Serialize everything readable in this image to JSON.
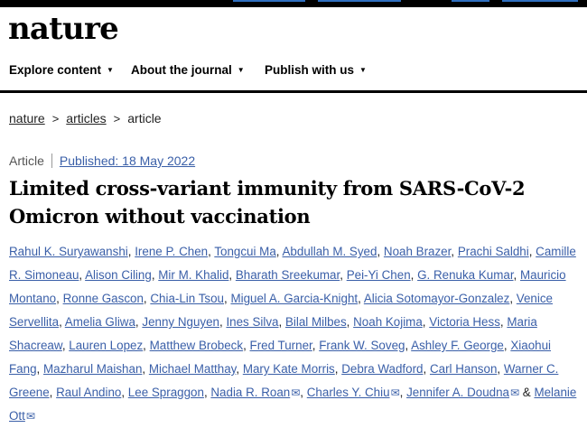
{
  "header": {
    "logo": "nature",
    "nav": [
      {
        "label": "Explore content"
      },
      {
        "label": "About the journal"
      },
      {
        "label": "Publish with us"
      }
    ]
  },
  "breadcrumb": [
    "nature",
    "articles",
    "article"
  ],
  "article": {
    "type": "Article",
    "published": "Published: 18 May 2022",
    "title_line1": "Limited cross-variant immunity from SARS-CoV-2",
    "title_line2": "Omicron without vaccination"
  },
  "authors": [
    {
      "name": "Rahul K. Suryawanshi"
    },
    {
      "name": "Irene P. Chen"
    },
    {
      "name": "Tongcui Ma"
    },
    {
      "name": "Abdullah M. Syed"
    },
    {
      "name": "Noah Brazer"
    },
    {
      "name": "Prachi Saldhi"
    },
    {
      "name": "Camille R. Simoneau"
    },
    {
      "name": "Alison Ciling"
    },
    {
      "name": "Mir M. Khalid"
    },
    {
      "name": "Bharath Sreekumar"
    },
    {
      "name": "Pei-Yi Chen"
    },
    {
      "name": "G. Renuka Kumar"
    },
    {
      "name": "Mauricio Montano"
    },
    {
      "name": "Ronne Gascon"
    },
    {
      "name": "Chia-Lin Tsou"
    },
    {
      "name": "Miguel A. Garcia-Knight"
    },
    {
      "name": "Alicia Sotomayor-Gonzalez"
    },
    {
      "name": "Venice Servellita"
    },
    {
      "name": "Amelia Gliwa"
    },
    {
      "name": "Jenny Nguyen"
    },
    {
      "name": "Ines Silva"
    },
    {
      "name": "Bilal Milbes"
    },
    {
      "name": "Noah Kojima"
    },
    {
      "name": "Victoria Hess"
    },
    {
      "name": "Maria Shacreaw"
    },
    {
      "name": "Lauren Lopez"
    },
    {
      "name": "Matthew Brobeck"
    },
    {
      "name": "Fred Turner"
    },
    {
      "name": "Frank W. Soveg"
    },
    {
      "name": "Ashley F. George"
    },
    {
      "name": "Xiaohui Fang"
    },
    {
      "name": "Mazharul Maishan"
    },
    {
      "name": "Michael Matthay"
    },
    {
      "name": "Mary Kate Morris"
    },
    {
      "name": "Debra Wadford"
    },
    {
      "name": "Carl Hanson"
    },
    {
      "name": "Warner C. Greene"
    },
    {
      "name": "Raul Andino"
    },
    {
      "name": "Lee Spraggon"
    },
    {
      "name": "Nadia R. Roan",
      "email": true
    },
    {
      "name": "Charles Y. Chiu",
      "email": true
    },
    {
      "name": "Jennifer A. Doudna",
      "email": true
    },
    {
      "name": "Melanie Ott",
      "email": true,
      "ampersand": "&"
    }
  ],
  "colors": {
    "link": "#3a5fa8",
    "text": "#222222",
    "logo": "#000000",
    "topbar_accent": "#2f6fbf"
  }
}
